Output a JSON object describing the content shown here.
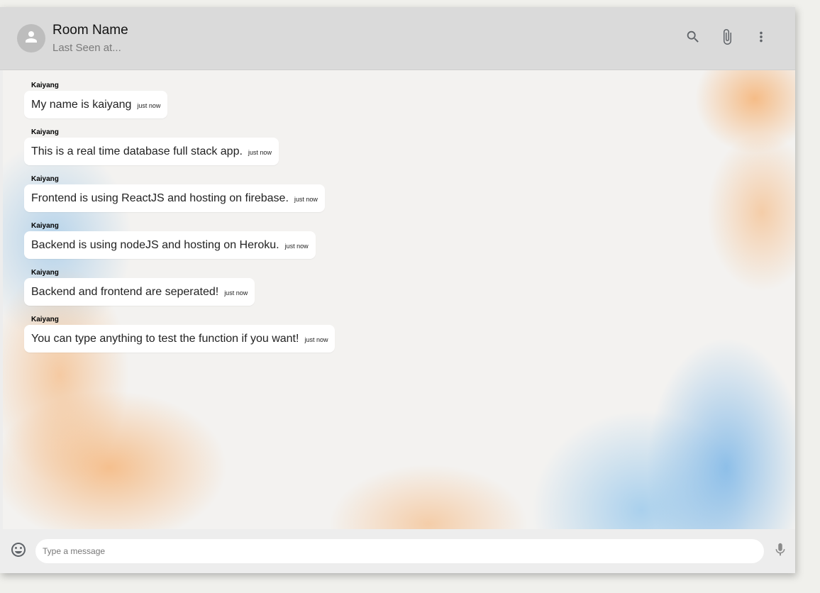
{
  "header": {
    "room_name": "Room Name",
    "last_seen": "Last Seen at..."
  },
  "icons": {
    "avatar": "person-icon",
    "search": "search-icon",
    "attach": "attach-icon",
    "more": "more-vert-icon",
    "emoji": "emoji-icon",
    "mic": "mic-icon"
  },
  "messages": [
    {
      "name": "Kaiyang",
      "text": "My name is kaiyang",
      "time": "just now"
    },
    {
      "name": "Kaiyang",
      "text": "This is a real time database full stack app.",
      "time": "just now"
    },
    {
      "name": "Kaiyang",
      "text": "Frontend is using ReactJS and hosting on firebase.",
      "time": "just now"
    },
    {
      "name": "Kaiyang",
      "text": "Backend is using nodeJS and hosting on Heroku.",
      "time": "just now"
    },
    {
      "name": "Kaiyang",
      "text": "Backend and frontend are seperated!",
      "time": "just now"
    },
    {
      "name": "Kaiyang",
      "text": "You can type anything to test the function if you want!",
      "time": "just now"
    }
  ],
  "footer": {
    "input_placeholder": "Type a message",
    "input_value": ""
  },
  "colors": {
    "header_bg": "#dadada",
    "bubble_bg": "#ffffff",
    "icon": "#5f6368"
  }
}
